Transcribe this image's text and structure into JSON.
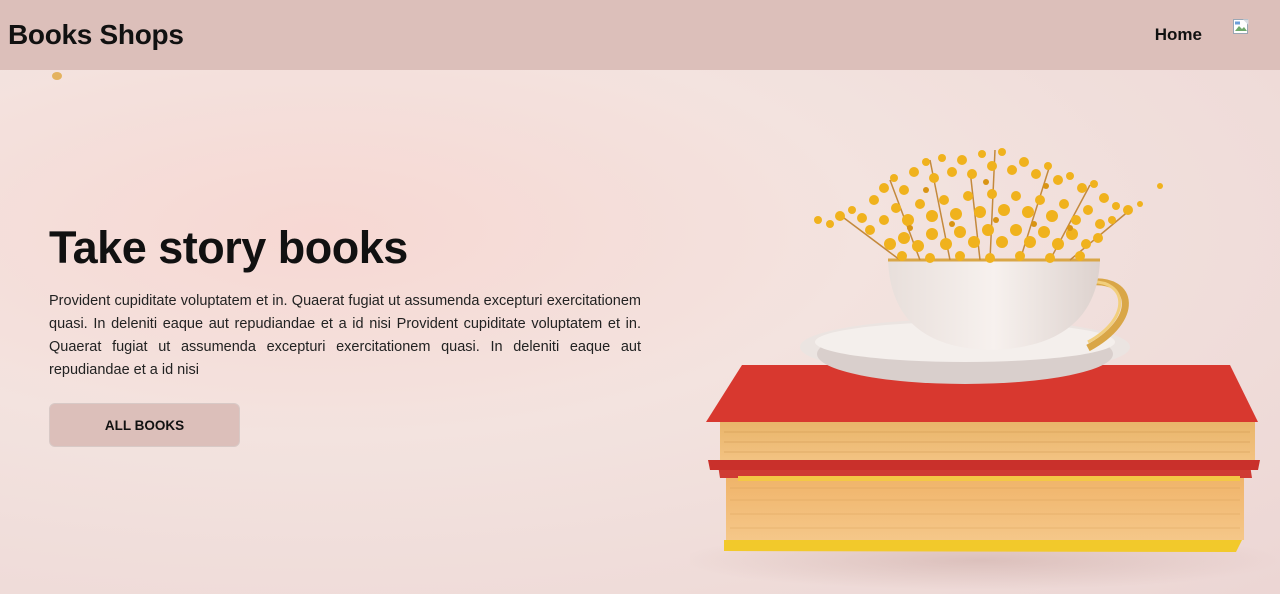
{
  "navbar": {
    "brand": "Books Shops",
    "links": [
      {
        "label": "Home"
      }
    ]
  },
  "hero": {
    "title": "Take story books",
    "description": "Provident cupiditate voluptatem et in. Quaerat fugiat ut assumenda excepturi exercitationem quasi. In deleniti eaque aut repudiandae et a id nisi Provident cupiditate voluptatem et in. Quaerat fugiat ut assumenda excepturi exercitationem quasi. In deleniti eaque aut repudiandae et a id nisi",
    "button_label": "ALL BOOKS"
  },
  "colors": {
    "navbar_bg": "#dcbfba",
    "button_bg": "#dcbfba",
    "book_red": "#d8382f",
    "pages_yellow": "#f2b866",
    "flowers": "#f0b21d"
  },
  "icons": {
    "profile_image": "broken-image-icon"
  }
}
